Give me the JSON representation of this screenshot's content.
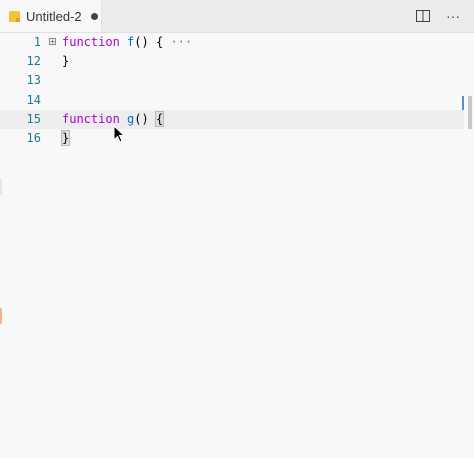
{
  "tab": {
    "title": "Untitled-2",
    "file_icon": "file-icon",
    "dirty": true
  },
  "actions": [
    {
      "name": "split-editor-icon",
      "glyph": "◫"
    },
    {
      "name": "more-actions-icon",
      "glyph": "···"
    }
  ],
  "editor": {
    "lines": [
      {
        "number": "1",
        "tokens": [
          {
            "t": "function",
            "c": "kw-purple"
          },
          {
            "t": " ",
            "c": ""
          },
          {
            "t": "f",
            "c": "fn-blue"
          },
          {
            "t": "() {",
            "c": ""
          },
          {
            "t": " ···",
            "c": "ellipsis"
          }
        ],
        "folded": true
      },
      {
        "number": "12",
        "tokens": [
          {
            "t": "}",
            "c": ""
          }
        ]
      },
      {
        "number": "13",
        "tokens": []
      },
      {
        "number": "14",
        "tokens": []
      },
      {
        "number": "15",
        "tokens": [
          {
            "t": "function",
            "c": "kw-purple"
          },
          {
            "t": " ",
            "c": ""
          },
          {
            "t": "g",
            "c": "fn-blue"
          },
          {
            "t": "() ",
            "c": ""
          },
          {
            "t": "{",
            "c": "bracket-hl"
          }
        ],
        "active": true
      },
      {
        "number": "16",
        "tokens": [
          {
            "t": "}",
            "c": "bracket-hl"
          }
        ]
      }
    ]
  },
  "colors": {
    "keyword": "#af00db",
    "function_name": "#0070c1",
    "line_number": "#237893",
    "dirty_dot": "#424242"
  }
}
